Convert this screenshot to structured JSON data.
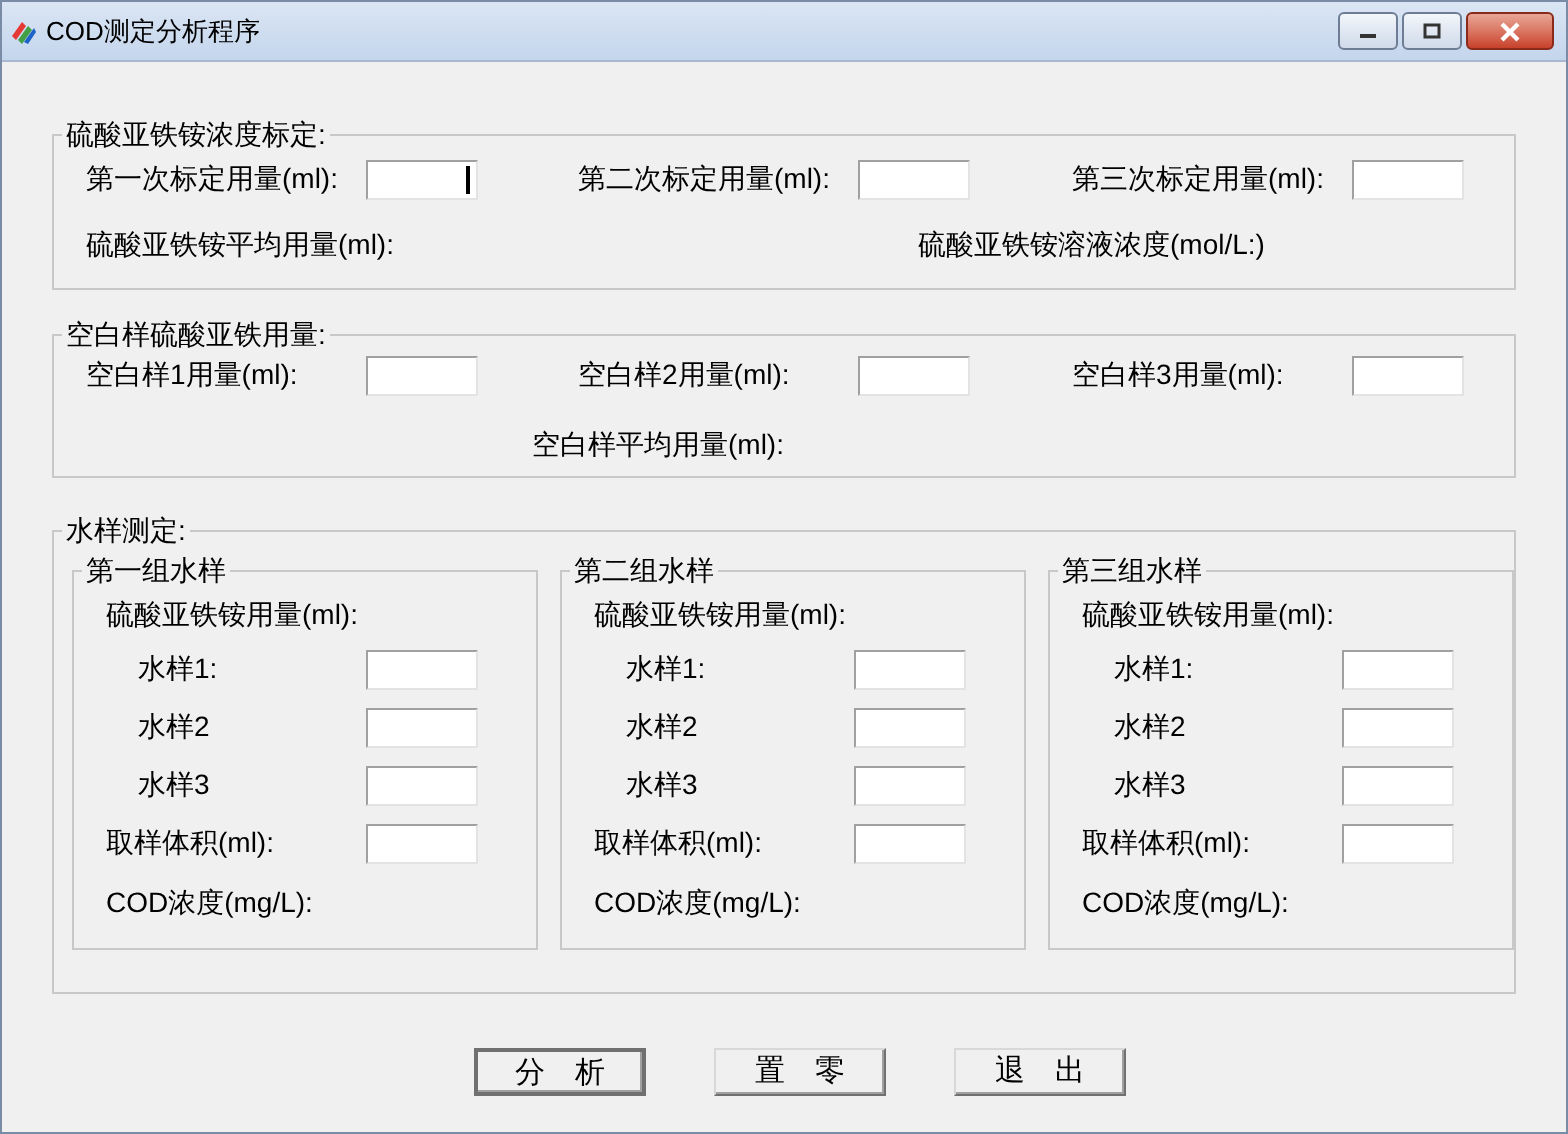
{
  "window": {
    "title": "COD测定分析程序"
  },
  "standardization": {
    "title": "硫酸亚铁铵浓度标定:",
    "fields": [
      {
        "label": "第一次标定用量(ml):",
        "focused": true
      },
      {
        "label": "第二次标定用量(ml):",
        "focused": false
      },
      {
        "label": "第三次标定用量(ml):",
        "focused": false
      }
    ],
    "results": [
      "硫酸亚铁铵平均用量(ml):",
      "硫酸亚铁铵溶液浓度(mol/L:)"
    ]
  },
  "blank": {
    "title": "空白样硫酸亚铁用量:",
    "fields": [
      {
        "label": "空白样1用量(ml):"
      },
      {
        "label": "空白样2用量(ml):"
      },
      {
        "label": "空白样3用量(ml):"
      }
    ],
    "result": "空白样平均用量(ml):"
  },
  "water": {
    "title": "水样测定:",
    "groups": [
      {
        "title": "第一组水样",
        "heading": "硫酸亚铁铵用量(ml):",
        "samples": [
          {
            "label": "水样1:"
          },
          {
            "label": "水样2"
          },
          {
            "label": "水样3"
          }
        ],
        "volume": {
          "label": "取样体积(ml):"
        },
        "result": "COD浓度(mg/L):"
      },
      {
        "title": "第二组水样",
        "heading": "硫酸亚铁铵用量(ml):",
        "samples": [
          {
            "label": "水样1:"
          },
          {
            "label": "水样2"
          },
          {
            "label": "水样3"
          }
        ],
        "volume": {
          "label": "取样体积(ml):"
        },
        "result": "COD浓度(mg/L):"
      },
      {
        "title": "第三组水样",
        "heading": "硫酸亚铁铵用量(ml):",
        "samples": [
          {
            "label": "水样1:"
          },
          {
            "label": "水样2"
          },
          {
            "label": "水样3"
          }
        ],
        "volume": {
          "label": "取样体积(ml):"
        },
        "result": "COD浓度(mg/L):"
      }
    ]
  },
  "buttons": [
    {
      "label": "分　析",
      "default": true
    },
    {
      "label": "置　零",
      "default": false
    },
    {
      "label": "退　出",
      "default": false
    }
  ]
}
